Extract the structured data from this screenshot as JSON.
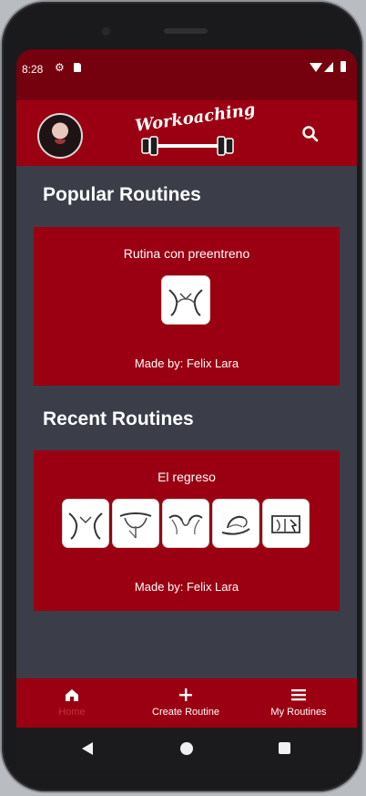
{
  "statusbar": {
    "time": "8:28",
    "settings_icon": "gear-icon",
    "sd_icon": "sd-card-icon",
    "wifi_icon": "wifi-icon",
    "signal_icon": "signal-icon",
    "battery_icon": "battery-icon"
  },
  "appbar": {
    "avatar_icon": "profile-avatar",
    "logo_text": "Workoaching",
    "logo_icon": "barbell-icon",
    "search_icon": "search-icon"
  },
  "popular": {
    "title": "Popular Routines",
    "cards": [
      {
        "name": "Rutina con preentreno",
        "author": "Made by: Felix Lara",
        "exercises": [
          "lat-muscle-icon"
        ]
      }
    ]
  },
  "recent": {
    "title": "Recent Routines",
    "cards": [
      {
        "name": "El regreso",
        "author": "Made by: Felix Lara",
        "exercises": [
          "lat-muscle-icon",
          "chest-muscle-icon",
          "shoulder-muscle-icon",
          "bicep-muscle-icon",
          "quad-muscle-icon"
        ]
      }
    ]
  },
  "bottomnav": {
    "items": [
      {
        "label": "Home",
        "icon": "home-icon"
      },
      {
        "label": "Create Routine",
        "icon": "plus-icon"
      },
      {
        "label": "My Routines",
        "icon": "menu-icon"
      }
    ]
  },
  "system_nav": {
    "back_icon": "back-icon",
    "home_icon": "home-circle-icon",
    "recent_icon": "recent-apps-icon"
  },
  "colors": {
    "accent": "#9b0012",
    "status_bar": "#75000e",
    "background": "#3b3d49",
    "text": "#ffffff"
  }
}
